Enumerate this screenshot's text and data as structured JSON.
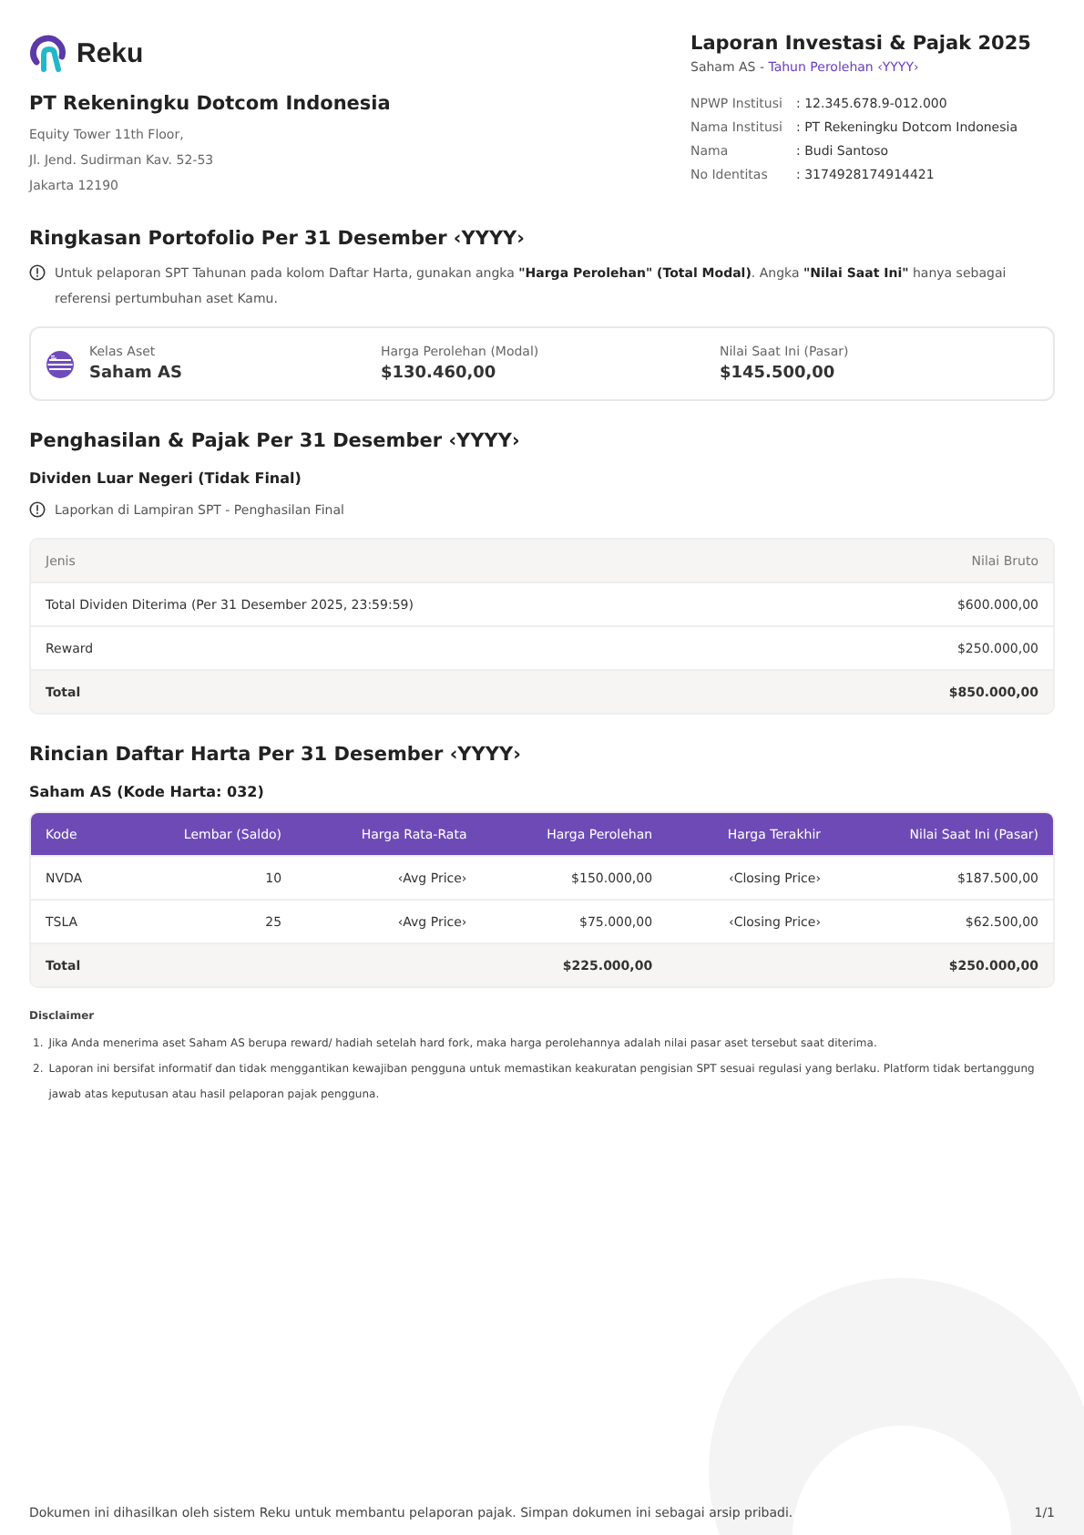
{
  "logo": {
    "name": "Reku"
  },
  "company": {
    "name": "PT Rekeningku Dotcom Indonesia",
    "address": [
      "Equity Tower 11th Floor,",
      "Jl. Jend. Sudirman Kav. 52-53",
      "Jakarta 12190"
    ]
  },
  "report": {
    "title": "Laporan Investasi & Pajak 2025",
    "subtitle": "Saham AS - ",
    "subtitle_link": "Tahun Perolehan ‹YYYY›",
    "info": [
      {
        "label": "NPWP Institusi",
        "value": ": 12.345.678.9-012.000"
      },
      {
        "label": "Nama Institusi",
        "value": ": PT Rekeningku Dotcom Indonesia"
      },
      {
        "label": "Nama",
        "value": ": Budi Santoso"
      },
      {
        "label": "No Identitas",
        "value": ": 3174928174914421"
      }
    ]
  },
  "summary": {
    "title": "Ringkasan Portofolio Per 31 Desember ‹YYYY›",
    "note": "Untuk pelaporan SPT Tahunan pada kolom Daftar Harta, gunakan angka **\"Harga Perolehan\" (Total Modal)**. Angka **\"Nilai Saat Ini\"** hanya sebagai referensi pertumbuhan aset Kamu.",
    "fields": [
      {
        "label": "Kelas Aset",
        "value": "Saham AS"
      },
      {
        "label": "Harga Perolehan (Modal)",
        "value": "$130.460,00"
      },
      {
        "label": "Nilai Saat Ini (Pasar)",
        "value": "$145.500,00"
      }
    ]
  },
  "income": {
    "title": "Penghasilan & Pajak Per 31 Desember ‹YYYY›",
    "subtitle": "Dividen Luar Negeri (Tidak Final)",
    "note": "Laporkan di Lampiran SPT - Penghasilan Final",
    "columns": [
      "Jenis",
      "Nilai Bruto"
    ],
    "rows": [
      {
        "kind": "row",
        "cells": [
          "Total Dividen Diterima (Per 31 Desember 2025, 23:59:59)",
          "$600.000,00"
        ]
      },
      {
        "kind": "row",
        "cells": [
          "Reward",
          "$250.000,00"
        ]
      },
      {
        "kind": "total",
        "cells": [
          "Total",
          "$850.000,00"
        ]
      }
    ]
  },
  "assets": {
    "title": "Rincian Daftar Harta Per 31 Desember ‹YYYY›",
    "subtitle": "Saham AS (Kode Harta: 032)",
    "columns": [
      "Kode",
      "Lembar (Saldo)",
      "Harga Rata-Rata",
      "Harga Perolehan",
      "Harga Terakhir",
      "Nilai Saat Ini (Pasar)"
    ],
    "rows": [
      {
        "kind": "row",
        "cells": [
          "NVDA",
          "10",
          "‹Avg Price›",
          "$150.000,00",
          "‹Closing Price›",
          "$187.500,00"
        ]
      },
      {
        "kind": "row",
        "cells": [
          "TSLA",
          "25",
          "‹Avg Price›",
          "$75.000,00",
          "‹Closing Price›",
          "$62.500,00"
        ]
      },
      {
        "kind": "total",
        "cells": [
          "Total",
          "",
          "",
          "$225.000,00",
          "",
          "$250.000,00"
        ]
      }
    ]
  },
  "disclaimer": {
    "title": "Disclaimer",
    "items": [
      {
        "number": "1.",
        "text": "Jika Anda menerima aset Saham AS berupa reward/ hadiah setelah hard fork, maka harga perolehannya adalah nilai pasar aset tersebut saat diterima."
      },
      {
        "number": "2.",
        "text": "Laporan ini bersifat informatif dan tidak menggantikan kewajiban pengguna untuk memastikan keakuratan pengisian SPT sesuai regulasi yang berlaku. Platform tidak bertanggung jawab atas keputusan atau hasil pelaporan pajak pengguna."
      }
    ]
  },
  "footer": {
    "text": "Dokumen ini dihasilkan oleh sistem Reku untuk membantu pelaporan pajak. Simpan dokumen ini sebagai arsip pribadi.",
    "page": "1/1"
  }
}
